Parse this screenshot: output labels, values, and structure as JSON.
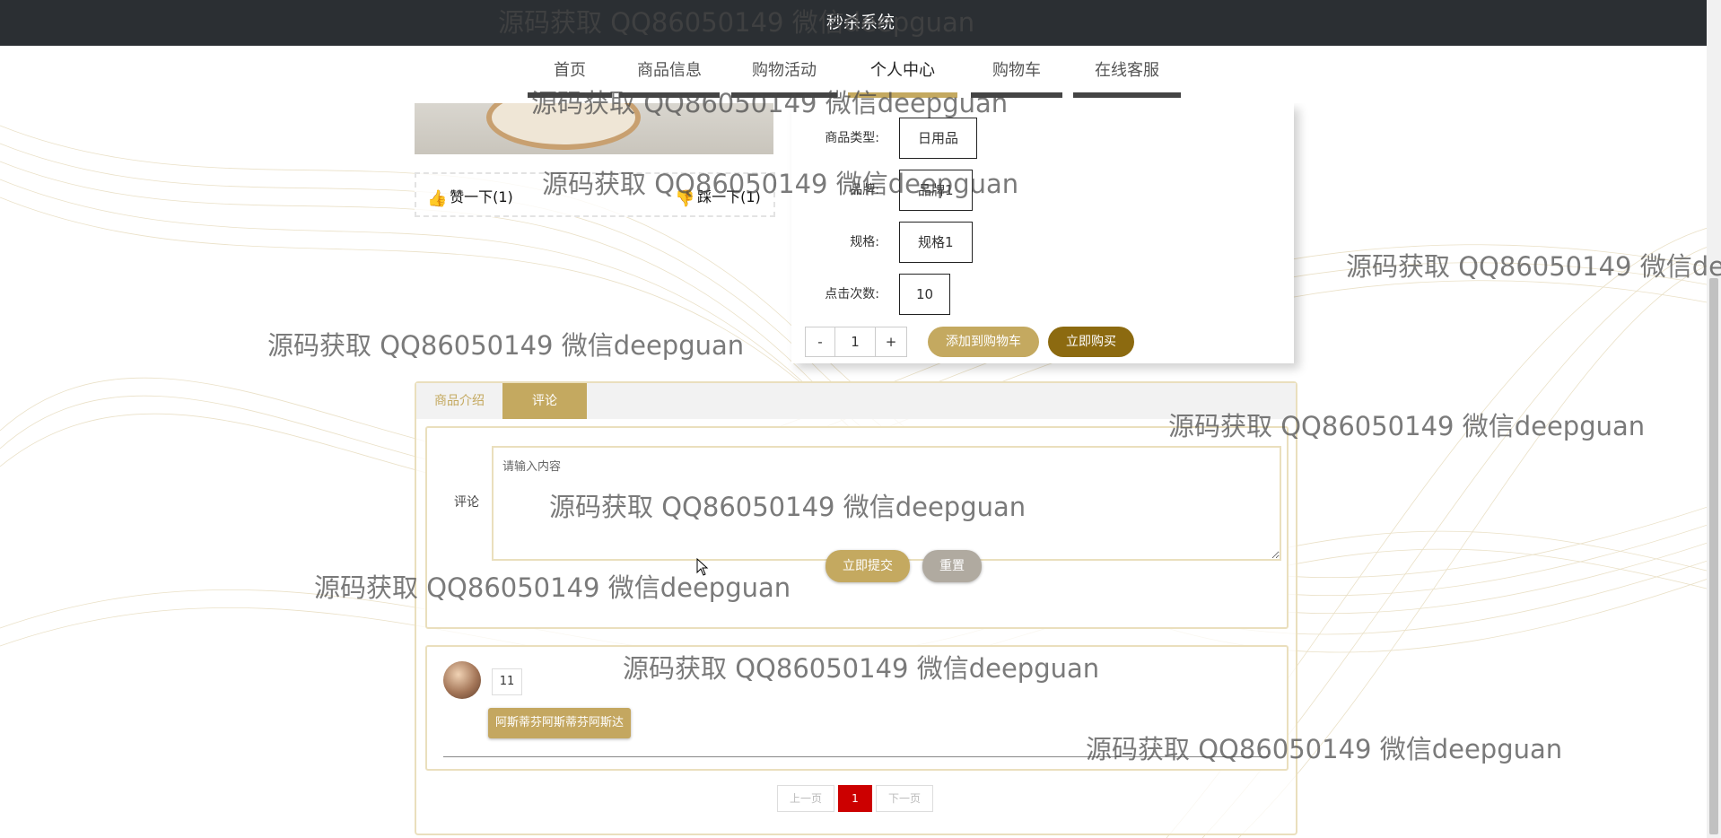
{
  "app": {
    "title": "秒杀系统"
  },
  "nav": {
    "items": [
      {
        "label": "首页"
      },
      {
        "label": "商品信息"
      },
      {
        "label": "购物活动"
      },
      {
        "label": "个人中心"
      },
      {
        "label": "购物车"
      },
      {
        "label": "在线客服"
      }
    ],
    "active_index": 3
  },
  "votes": {
    "like": "赞一下(1)",
    "dislike": "踩一下(1)"
  },
  "product": {
    "fields": [
      {
        "label": "商品类型:",
        "value": "日用品"
      },
      {
        "label": "品牌:",
        "value": "品牌1"
      },
      {
        "label": "规格:",
        "value": "规格1"
      },
      {
        "label": "点击次数:",
        "value": "10"
      }
    ],
    "quantity": "1",
    "minus_label": "-",
    "plus_label": "+",
    "add_to_cart": "添加到购物车",
    "buy_now": "立即购买"
  },
  "tabs": [
    {
      "label": "商品介绍"
    },
    {
      "label": "评论"
    }
  ],
  "active_tab": 1,
  "comment_form": {
    "label": "评论",
    "placeholder": "请输入内容",
    "submit": "立即提交",
    "reset": "重置"
  },
  "comments": [
    {
      "count": "11",
      "content": "阿斯蒂芬阿斯蒂芬阿斯达"
    }
  ],
  "pagination": {
    "prev": "上一页",
    "current": "1",
    "next": "下一页"
  },
  "watermark": "源码获取 QQ86050149 微信deepguan",
  "colors": {
    "accent": "#c4a960",
    "buy_now": "#8c6a10",
    "reset": "#b0aaa0",
    "pager_active": "#cc0000",
    "titlebar": "#2b2f33"
  }
}
